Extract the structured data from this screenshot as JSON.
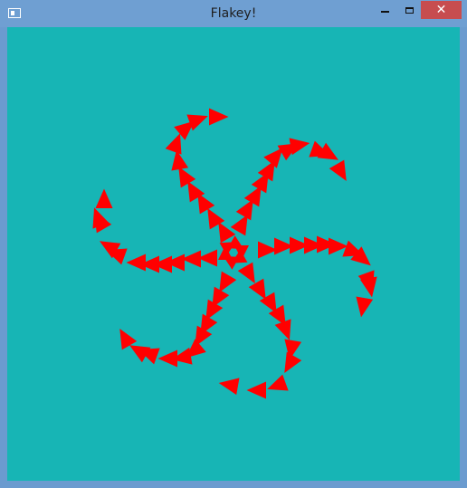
{
  "window": {
    "title": "Flakey!",
    "controls": {
      "minimize_icon": "minimize-icon",
      "maximize_icon": "maximize-icon",
      "close_glyph": "✕"
    }
  },
  "canvas": {
    "background_color": "#17b5b5",
    "shape_color": "#ff0000",
    "shape": "triangle",
    "arms": 6
  }
}
